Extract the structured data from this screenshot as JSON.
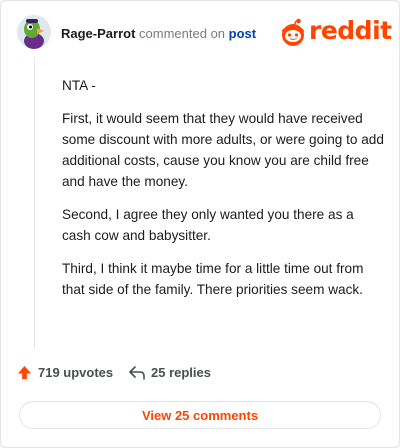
{
  "header": {
    "username": "Rage-Parrot",
    "action_text": "commented on",
    "link_text": "post",
    "brand": "reddit"
  },
  "comment": {
    "paragraphs": [
      "NTA -",
      "First, it would seem that they would have received some discount with more adults, or were going to add additional costs, cause you know you are child free and have the money.",
      "Second, I agree they only wanted you there as a cash cow and babysitter.",
      "Third, I think it maybe time for a little time out from that side of the family. There priorities seem wack."
    ]
  },
  "actions": {
    "upvotes_label": "719 upvotes",
    "replies_label": "25 replies"
  },
  "footer": {
    "view_comments_label": "View 25 comments"
  },
  "colors": {
    "brand": "#ff4500",
    "link": "#0045ac",
    "text": "#1c1c1c",
    "muted": "#787c7e"
  },
  "icons": [
    "avatar",
    "reddit-logo-icon",
    "upvote-arrow-icon",
    "reply-arrow-icon"
  ]
}
